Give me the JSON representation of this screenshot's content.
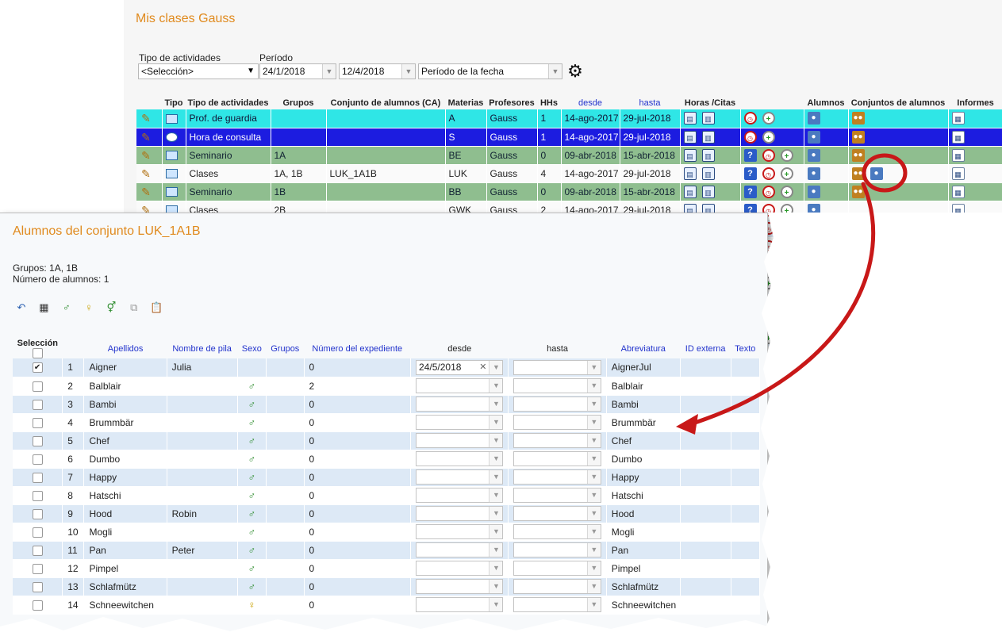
{
  "bg": {
    "title": "Mis clases Gauss",
    "filters": {
      "tipo_label": "Tipo de actividades",
      "tipo_value": "<Selección>",
      "periodo_label": "Período",
      "from": "24/1/2018",
      "to": "12/4/2018",
      "period_type": "Período de la fecha"
    },
    "columns": [
      "Tipo",
      "Tipo de actividades",
      "Grupos",
      "Conjunto de alumnos (CA)",
      "Materias",
      "Profesores",
      "HHs",
      "desde",
      "hasta",
      "Horas /Citas",
      "Alumnos",
      "Conjuntos de alumnos",
      "Informes"
    ],
    "rows": [
      {
        "style": "cyan",
        "tipo": "Prof. de guardia",
        "grupos": "",
        "ca": "",
        "materia": "A",
        "prof": "Gauss",
        "hhs": "1",
        "desde": "14-ago-2017",
        "hasta": "29-jul-2018"
      },
      {
        "style": "navy",
        "tipo": "Hora de consulta",
        "grupos": "",
        "ca": "",
        "materia": "S",
        "prof": "Gauss",
        "hhs": "1",
        "desde": "14-ago-2017",
        "hasta": "29-jul-2018"
      },
      {
        "style": "green",
        "tipo": "Seminario",
        "grupos": "1A",
        "ca": "",
        "materia": "BE",
        "prof": "Gauss",
        "hhs": "0",
        "desde": "09-abr-2018",
        "hasta": "15-abr-2018"
      },
      {
        "style": "white",
        "tipo": "Clases",
        "grupos": "1A, 1B",
        "ca": "LUK_1A1B",
        "materia": "LUK",
        "prof": "Gauss",
        "hhs": "4",
        "desde": "14-ago-2017",
        "hasta": "29-jul-2018"
      },
      {
        "style": "green",
        "tipo": "Seminario",
        "grupos": "1B",
        "ca": "",
        "materia": "BB",
        "prof": "Gauss",
        "hhs": "0",
        "desde": "09-abr-2018",
        "hasta": "15-abr-2018"
      },
      {
        "style": "white",
        "tipo": "Clases",
        "grupos": "2B",
        "ca": "",
        "materia": "GWK",
        "prof": "Gauss",
        "hhs": "2",
        "desde": "14-ago-2017",
        "hasta": "29-jul-2018"
      },
      {
        "style": "light",
        "tipo": "",
        "grupos": "",
        "ca": "",
        "materia": "",
        "prof": "",
        "hhs": "",
        "desde": "",
        "hasta": ""
      },
      {
        "style": "white",
        "tipo": "",
        "grupos": "",
        "ca": "",
        "materia": "",
        "prof": "",
        "hhs": "",
        "desde": "",
        "hasta": ""
      },
      {
        "style": "light",
        "tipo": "",
        "grupos": "",
        "ca": "",
        "materia": "",
        "prof": "",
        "hhs": "",
        "desde": "",
        "hasta": ""
      },
      {
        "style": "white",
        "tipo": "",
        "grupos": "",
        "ca": "",
        "materia": "",
        "prof": "",
        "hhs": "",
        "desde": "",
        "hasta": ""
      },
      {
        "style": "light",
        "tipo": "",
        "grupos": "",
        "ca": "",
        "materia": "",
        "prof": "",
        "hhs": "",
        "desde": "",
        "hasta": ""
      },
      {
        "style": "white",
        "tipo": "",
        "grupos": "",
        "ca": "",
        "materia": "",
        "prof": "",
        "hhs": "",
        "desde": "",
        "hasta": ""
      },
      {
        "style": "light",
        "tipo": "",
        "grupos": "",
        "ca": "",
        "materia": "",
        "prof": "",
        "hhs": "",
        "desde": "",
        "hasta": ""
      }
    ]
  },
  "dialog": {
    "title": "Alumnos del conjunto LUK_1A1B",
    "grupos_line": "Grupos: 1A, 1B",
    "count_line": "Número de alumnos: 1",
    "toolbar_icons": [
      "undo-icon",
      "grid-icon",
      "male-icon",
      "female-icon",
      "gender-both-icon",
      "copy-icon",
      "paste-icon"
    ],
    "headers": {
      "seleccion": "Selección",
      "apellidos": "Apellidos",
      "nombre": "Nombre de pila",
      "sexo": "Sexo",
      "grupos": "Grupos",
      "expediente": "Número del expediente",
      "desde": "desde",
      "hasta": "hasta",
      "abreviatura": "Abreviatura",
      "id_externa": "ID externa",
      "texto": "Texto"
    },
    "students": [
      {
        "n": "1",
        "apellido": "Aigner",
        "nombre": "Julia",
        "sexo": "",
        "exp": "0",
        "desde": "24/5/2018",
        "abrev": "AignerJul",
        "checked": true
      },
      {
        "n": "2",
        "apellido": "Balblair",
        "nombre": "",
        "sexo": "m",
        "exp": "2",
        "desde": "",
        "abrev": "Balblair",
        "checked": false
      },
      {
        "n": "3",
        "apellido": "Bambi",
        "nombre": "",
        "sexo": "m",
        "exp": "0",
        "desde": "",
        "abrev": "Bambi",
        "checked": false
      },
      {
        "n": "4",
        "apellido": "Brummbär",
        "nombre": "",
        "sexo": "m",
        "exp": "0",
        "desde": "",
        "abrev": "Brummbär",
        "checked": false
      },
      {
        "n": "5",
        "apellido": "Chef",
        "nombre": "",
        "sexo": "m",
        "exp": "0",
        "desde": "",
        "abrev": "Chef",
        "checked": false
      },
      {
        "n": "6",
        "apellido": "Dumbo",
        "nombre": "",
        "sexo": "m",
        "exp": "0",
        "desde": "",
        "abrev": "Dumbo",
        "checked": false
      },
      {
        "n": "7",
        "apellido": "Happy",
        "nombre": "",
        "sexo": "m",
        "exp": "0",
        "desde": "",
        "abrev": "Happy",
        "checked": false
      },
      {
        "n": "8",
        "apellido": "Hatschi",
        "nombre": "",
        "sexo": "m",
        "exp": "0",
        "desde": "",
        "abrev": "Hatschi",
        "checked": false
      },
      {
        "n": "9",
        "apellido": "Hood",
        "nombre": "Robin",
        "sexo": "m",
        "exp": "0",
        "desde": "",
        "abrev": "Hood",
        "checked": false
      },
      {
        "n": "10",
        "apellido": "Mogli",
        "nombre": "",
        "sexo": "m",
        "exp": "0",
        "desde": "",
        "abrev": "Mogli",
        "checked": false
      },
      {
        "n": "11",
        "apellido": "Pan",
        "nombre": "Peter",
        "sexo": "m",
        "exp": "0",
        "desde": "",
        "abrev": "Pan",
        "checked": false
      },
      {
        "n": "12",
        "apellido": "Pimpel",
        "nombre": "",
        "sexo": "m",
        "exp": "0",
        "desde": "",
        "abrev": "Pimpel",
        "checked": false
      },
      {
        "n": "13",
        "apellido": "Schlafmütz",
        "nombre": "",
        "sexo": "m",
        "exp": "0",
        "desde": "",
        "abrev": "Schlafmütz",
        "checked": false
      },
      {
        "n": "14",
        "apellido": "Schneewitchen",
        "nombre": "",
        "sexo": "f",
        "exp": "0",
        "desde": "",
        "abrev": "Schneewitchen",
        "checked": false
      }
    ]
  },
  "colors": {
    "title_orange": "#e08a1e",
    "annotation_red": "#c81818",
    "row_blue": "#dde9f6",
    "row_cyan": "#2fe6e6",
    "row_navy": "#1c1ce0",
    "row_green": "#8fbe8f"
  }
}
